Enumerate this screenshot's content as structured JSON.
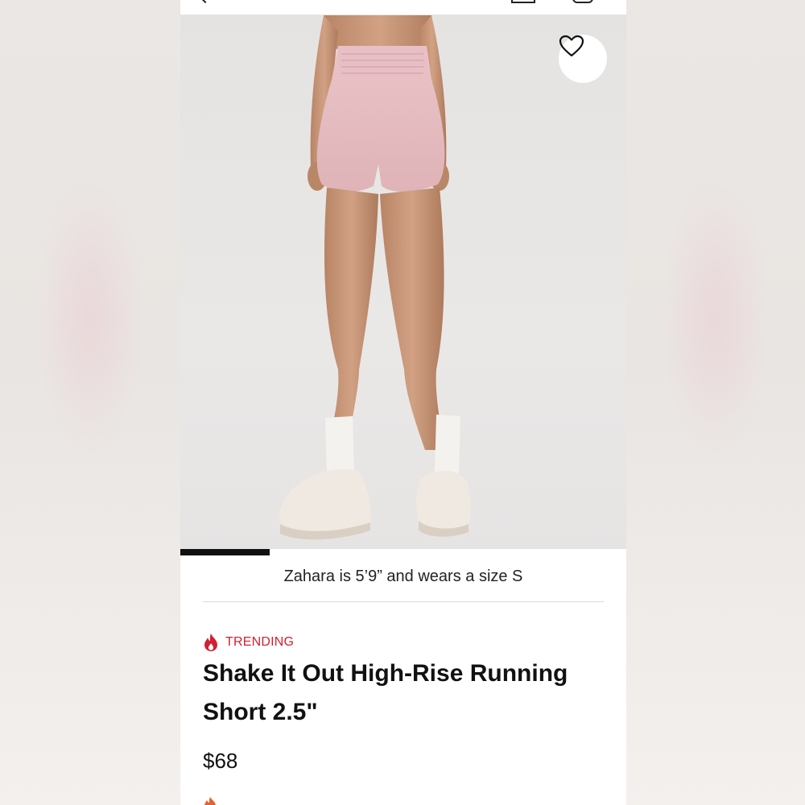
{
  "header": {
    "icons": [
      "back-chevron-icon",
      "bag-icon",
      "account-icon"
    ]
  },
  "gallery": {
    "image_alt": "Model wearing pink high-rise running shorts with white socks and sneakers",
    "progress": 0.2,
    "wishlist_icon": "heart-outline-icon"
  },
  "product": {
    "model_caption": "Zahara is 5’9” and wears a size S",
    "badge": {
      "label": "TRENDING",
      "icon": "flame-icon",
      "color": "#d22030"
    },
    "title": "Shake It Out High-Rise Running Short 2.5\"",
    "price": "$68"
  }
}
